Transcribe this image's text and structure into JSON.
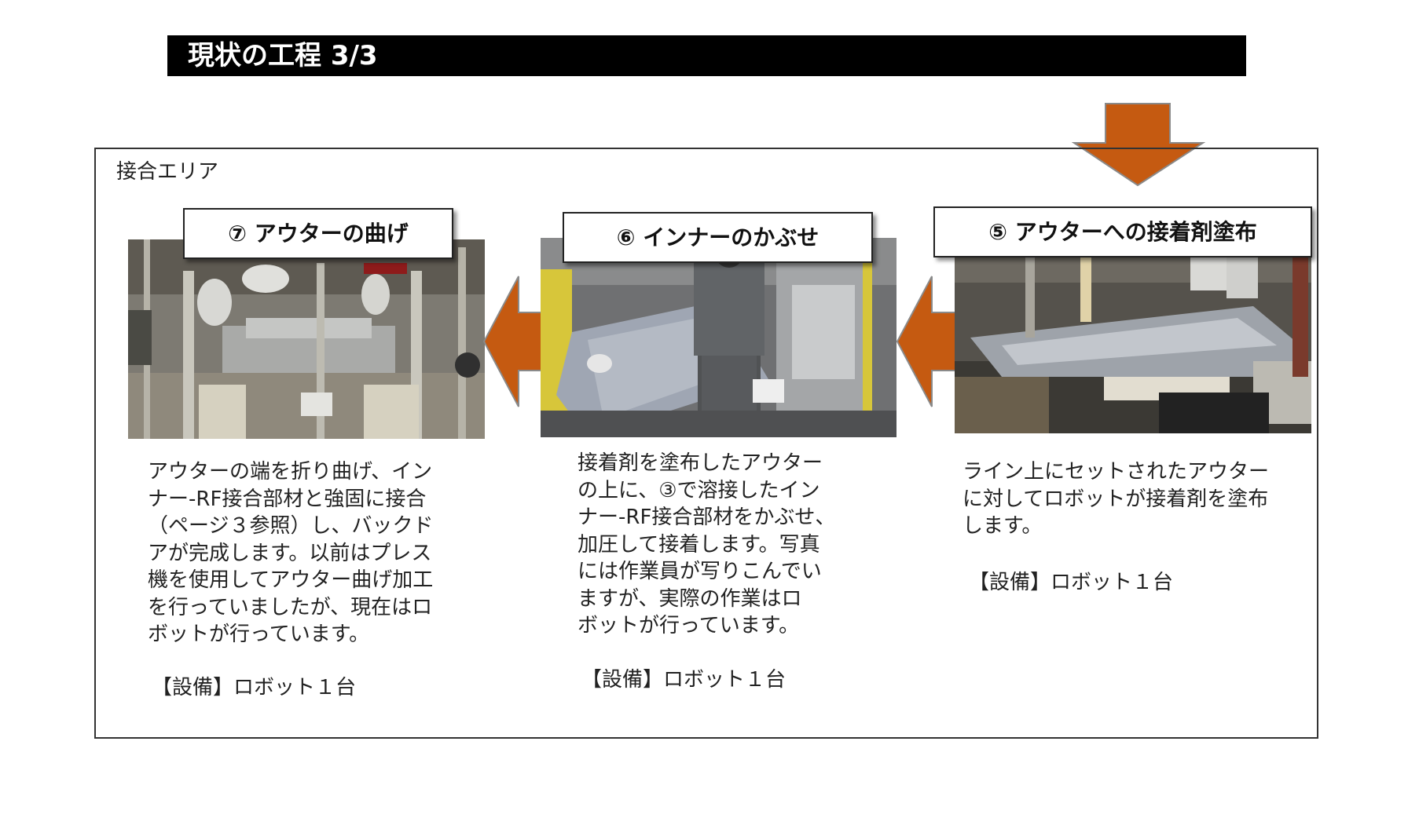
{
  "title": "現状の工程 3/3",
  "area_label": "接合エリア",
  "colors": {
    "arrow": "#C55A11",
    "arrow_stroke": "#8A8A8A",
    "title_bg": "#000000"
  },
  "steps": [
    {
      "label": "⑤ アウターへの接着剤塗布",
      "description": "ライン上にセットされたアウター\nに対してロボットが接着剤を塗布\nします。",
      "equipment": "【設備】ロボット１台"
    },
    {
      "label": "⑥ インナーのかぶせ",
      "description": "接着剤を塗布したアウター\nの上に、③で溶接したイン\nナー-RF接合部材をかぶせ、\n加圧して接着します。写真\nには作業員が写りこんでい\nますが、実際の作業はロ\nボットが行っています。",
      "equipment": "【設備】ロボット１台"
    },
    {
      "label": "⑦ アウターの曲げ",
      "description": "アウターの端を折り曲げ、イン\nナー-RF接合部材と強固に接合\n（ページ３参照）し、バックド\nアが完成します。以前はプレス\n機を使用してアウター曲げ加工\nを行っていましたが、現在はロ\nボットが行っています。",
      "equipment": "【設備】ロボット１台"
    }
  ]
}
